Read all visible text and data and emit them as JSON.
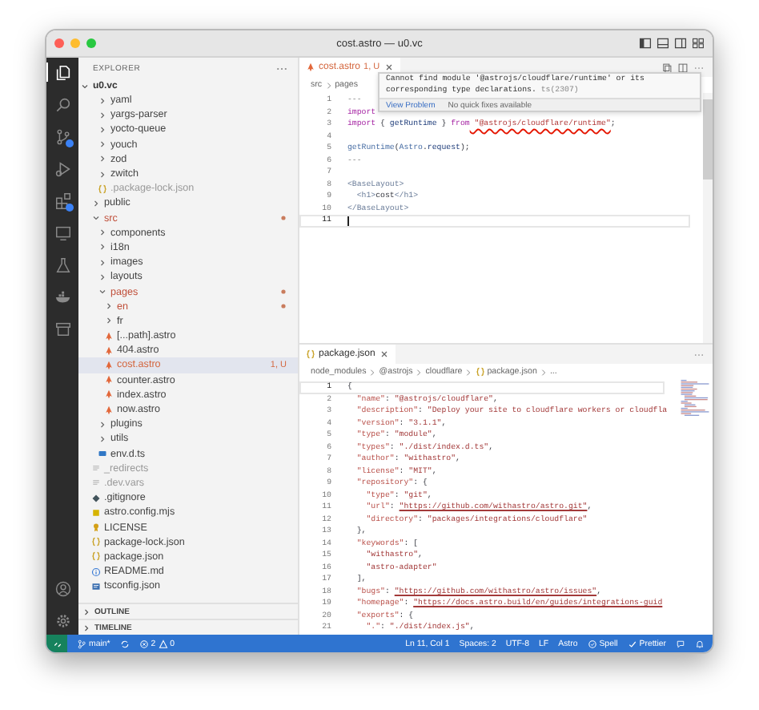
{
  "window": {
    "title": "cost.astro — u0.vc"
  },
  "activity_bar": [
    {
      "kind": "explorer",
      "selected": true,
      "badge": false
    },
    {
      "kind": "search",
      "selected": false,
      "badge": false
    },
    {
      "kind": "source_control",
      "selected": false,
      "badge": true
    },
    {
      "kind": "run",
      "selected": false,
      "badge": false
    },
    {
      "kind": "extensions",
      "selected": false,
      "badge": true
    },
    {
      "kind": "remote",
      "selected": false,
      "badge": false
    },
    {
      "kind": "testing",
      "selected": false,
      "badge": false
    },
    {
      "kind": "docker",
      "selected": false,
      "badge": false
    },
    {
      "kind": "archive",
      "selected": false,
      "badge": false
    }
  ],
  "activity_bar_bottom": [
    {
      "kind": "account"
    },
    {
      "kind": "settings"
    }
  ],
  "sidebar": {
    "title": "EXPLORER",
    "root": {
      "label": "u0.vc",
      "expanded": true
    },
    "tree": [
      {
        "kind": "continued",
        "children": [
          {
            "label": "yaml",
            "kind": "folder",
            "expanded": false,
            "modified": false,
            "ignored": false,
            "selected": false
          },
          {
            "label": "yargs-parser",
            "kind": "folder",
            "expanded": false,
            "modified": false,
            "ignored": false,
            "selected": false
          },
          {
            "label": "yocto-queue",
            "kind": "folder",
            "expanded": false,
            "modified": false,
            "ignored": false,
            "selected": false
          },
          {
            "label": "youch",
            "kind": "folder",
            "expanded": false,
            "modified": false,
            "ignored": false,
            "selected": false
          },
          {
            "label": "zod",
            "kind": "folder",
            "expanded": false,
            "modified": false,
            "ignored": false,
            "selected": false
          },
          {
            "label": "zwitch",
            "kind": "folder",
            "expanded": false,
            "modified": false,
            "ignored": false,
            "selected": false
          },
          {
            "label": ".package-lock.json",
            "kind": "json",
            "modified": false,
            "ignored": true,
            "selected": false
          }
        ]
      },
      {
        "label": "public",
        "kind": "folder",
        "expanded": false,
        "modified": false,
        "ignored": false,
        "selected": false
      },
      {
        "label": "src",
        "kind": "folder",
        "expanded": true,
        "modified": true,
        "ignored": false,
        "selected": false,
        "children": [
          {
            "label": "components",
            "kind": "folder",
            "expanded": false,
            "modified": false,
            "ignored": false,
            "selected": false
          },
          {
            "label": "i18n",
            "kind": "folder",
            "expanded": false,
            "modified": false,
            "ignored": false,
            "selected": false
          },
          {
            "label": "images",
            "kind": "folder",
            "expanded": false,
            "modified": false,
            "ignored": false,
            "selected": false
          },
          {
            "label": "layouts",
            "kind": "folder",
            "expanded": false,
            "modified": false,
            "ignored": false,
            "selected": false
          },
          {
            "label": "pages",
            "kind": "folder",
            "expanded": true,
            "modified": true,
            "ignored": false,
            "selected": false,
            "children": [
              {
                "label": "en",
                "kind": "folder",
                "expanded": false,
                "modified": true,
                "ignored": false,
                "selected": false
              },
              {
                "label": "fr",
                "kind": "folder",
                "expanded": false,
                "modified": false,
                "ignored": false,
                "selected": false
              },
              {
                "label": "[...path].astro",
                "kind": "astro",
                "modified": false,
                "ignored": false,
                "selected": false
              },
              {
                "label": "404.astro",
                "kind": "astro",
                "modified": false,
                "ignored": false,
                "selected": false
              },
              {
                "label": "cost.astro",
                "kind": "astro",
                "modified": false,
                "ignored": false,
                "decoration": "1, U",
                "selected": true
              },
              {
                "label": "counter.astro",
                "kind": "astro",
                "modified": false,
                "ignored": false,
                "selected": false
              },
              {
                "label": "index.astro",
                "kind": "astro",
                "modified": false,
                "ignored": false,
                "selected": false
              },
              {
                "label": "now.astro",
                "kind": "astro",
                "modified": false,
                "ignored": false,
                "selected": false
              }
            ]
          },
          {
            "label": "plugins",
            "kind": "folder",
            "expanded": false,
            "modified": false,
            "ignored": false,
            "selected": false
          },
          {
            "label": "utils",
            "kind": "folder",
            "expanded": false,
            "modified": false,
            "ignored": false,
            "selected": false
          },
          {
            "label": "env.d.ts",
            "kind": "ts",
            "modified": false,
            "ignored": false,
            "selected": false
          }
        ]
      },
      {
        "label": "_redirects",
        "kind": "text",
        "modified": false,
        "ignored": true,
        "selected": false
      },
      {
        "label": ".dev.vars",
        "kind": "text",
        "modified": false,
        "ignored": true,
        "selected": false
      },
      {
        "label": ".gitignore",
        "kind": "git",
        "modified": false,
        "ignored": false,
        "selected": false
      },
      {
        "label": "astro.config.mjs",
        "kind": "js",
        "modified": false,
        "ignored": false,
        "selected": false
      },
      {
        "label": "LICENSE",
        "kind": "license",
        "modified": false,
        "ignored": false,
        "selected": false
      },
      {
        "label": "package-lock.json",
        "kind": "json",
        "modified": false,
        "ignored": false,
        "selected": false
      },
      {
        "label": "package.json",
        "kind": "json",
        "modified": false,
        "ignored": false,
        "selected": false
      },
      {
        "label": "README.md",
        "kind": "info",
        "modified": false,
        "ignored": false,
        "selected": false
      },
      {
        "label": "tsconfig.json",
        "kind": "tsconfig",
        "modified": false,
        "ignored": false,
        "selected": false
      }
    ],
    "sections": [
      {
        "label": "OUTLINE",
        "expanded": false
      },
      {
        "label": "TIMELINE",
        "expanded": false
      }
    ]
  },
  "editors": [
    {
      "tab": {
        "label": "cost.astro",
        "kind": "astro",
        "decoration": "1, U",
        "selected": true
      },
      "breadcrumb": [
        {
          "label": "src",
          "kind": "folder"
        },
        {
          "label": "pages",
          "kind": "folder"
        }
      ],
      "lines": [
        {
          "number": "1",
          "current": false,
          "tokens": [
            {
              "text": "---",
              "kind": "punct"
            }
          ]
        },
        {
          "number": "2",
          "current": false,
          "tokens": [
            {
              "text": "import",
              "kind": "keyword"
            }
          ]
        },
        {
          "number": "3",
          "current": false,
          "tokens": [
            {
              "text": "import",
              "kind": "keyword"
            },
            {
              "text": " { ",
              "kind": "text"
            },
            {
              "text": "getRuntime",
              "kind": "variable"
            },
            {
              "text": " } ",
              "kind": "text"
            },
            {
              "text": "from",
              "kind": "keyword"
            },
            {
              "text": " \"@astrojs/cloudflare/runtime\"",
              "kind": "error"
            },
            {
              "text": ";",
              "kind": "text"
            }
          ]
        },
        {
          "number": "4",
          "current": false
        },
        {
          "number": "5",
          "current": false,
          "tokens": [
            {
              "text": "getRuntime",
              "kind": "function"
            },
            {
              "text": "(",
              "kind": "text"
            },
            {
              "text": "Astro",
              "kind": "type"
            },
            {
              "text": ".",
              "kind": "text"
            },
            {
              "text": "request",
              "kind": "variable"
            },
            {
              "text": ");",
              "kind": "text"
            }
          ]
        },
        {
          "number": "6",
          "current": false,
          "tokens": [
            {
              "text": "---",
              "kind": "punct"
            }
          ]
        },
        {
          "number": "7",
          "current": false
        },
        {
          "number": "8",
          "current": false,
          "tokens": [
            {
              "text": "<BaseLayout>",
              "kind": "tag"
            }
          ]
        },
        {
          "number": "9",
          "current": false,
          "tokens": [
            {
              "text": "  <h1>",
              "kind": "tag"
            },
            {
              "text": "cost",
              "kind": "text"
            },
            {
              "text": "</h1>",
              "kind": "tag"
            }
          ]
        },
        {
          "number": "10",
          "current": false,
          "tokens": [
            {
              "text": "</BaseLayout>",
              "kind": "tag"
            }
          ]
        },
        {
          "number": "11",
          "current": true
        }
      ],
      "hover": {
        "message": "Cannot find module '@astrojs/cloudflare/runtime' or its corresponding type declarations.",
        "code": "ts(2307)",
        "actions": [
          "View Problem",
          "No quick fixes available"
        ]
      }
    },
    {
      "tab": {
        "label": "package.json",
        "kind": "json",
        "selected": true
      },
      "breadcrumb": [
        {
          "label": "node_modules",
          "kind": "folder"
        },
        {
          "label": "@astrojs",
          "kind": "folder"
        },
        {
          "label": "cloudflare",
          "kind": "folder"
        },
        {
          "label": "package.json",
          "kind": "json"
        },
        {
          "label": "...",
          "kind": "folder"
        }
      ],
      "lines": [
        {
          "number": "1",
          "current": true,
          "tokens": [
            {
              "text": "{",
              "kind": "text"
            }
          ]
        },
        {
          "number": "2",
          "current": false,
          "tokens": [
            {
              "text": "  \"name\"",
              "kind": "key"
            },
            {
              "text": ": ",
              "kind": "text"
            },
            {
              "text": "\"@astrojs/cloudflare\"",
              "kind": "string"
            },
            {
              "text": ",",
              "kind": "text"
            }
          ]
        },
        {
          "number": "3",
          "current": false,
          "tokens": [
            {
              "text": "  \"description\"",
              "kind": "key"
            },
            {
              "text": ": ",
              "kind": "text"
            },
            {
              "text": "\"Deploy your site to cloudflare workers or cloudfla",
              "kind": "string"
            }
          ]
        },
        {
          "number": "4",
          "current": false,
          "tokens": [
            {
              "text": "  \"version\"",
              "kind": "key"
            },
            {
              "text": ": ",
              "kind": "text"
            },
            {
              "text": "\"3.1.1\"",
              "kind": "string"
            },
            {
              "text": ",",
              "kind": "text"
            }
          ]
        },
        {
          "number": "5",
          "current": false,
          "tokens": [
            {
              "text": "  \"type\"",
              "kind": "key"
            },
            {
              "text": ": ",
              "kind": "text"
            },
            {
              "text": "\"module\"",
              "kind": "string"
            },
            {
              "text": ",",
              "kind": "text"
            }
          ]
        },
        {
          "number": "6",
          "current": false,
          "tokens": [
            {
              "text": "  \"types\"",
              "kind": "key"
            },
            {
              "text": ": ",
              "kind": "text"
            },
            {
              "text": "\"./dist/index.d.ts\"",
              "kind": "string"
            },
            {
              "text": ",",
              "kind": "text"
            }
          ]
        },
        {
          "number": "7",
          "current": false,
          "tokens": [
            {
              "text": "  \"author\"",
              "kind": "key"
            },
            {
              "text": ": ",
              "kind": "text"
            },
            {
              "text": "\"withastro\"",
              "kind": "string"
            },
            {
              "text": ",",
              "kind": "text"
            }
          ]
        },
        {
          "number": "8",
          "current": false,
          "tokens": [
            {
              "text": "  \"license\"",
              "kind": "key"
            },
            {
              "text": ": ",
              "kind": "text"
            },
            {
              "text": "\"MIT\"",
              "kind": "string"
            },
            {
              "text": ",",
              "kind": "text"
            }
          ]
        },
        {
          "number": "9",
          "current": false,
          "tokens": [
            {
              "text": "  \"repository\"",
              "kind": "key"
            },
            {
              "text": ": {",
              "kind": "text"
            }
          ]
        },
        {
          "number": "10",
          "current": false,
          "tokens": [
            {
              "text": "    \"type\"",
              "kind": "key"
            },
            {
              "text": ": ",
              "kind": "text"
            },
            {
              "text": "\"git\"",
              "kind": "string"
            },
            {
              "text": ",",
              "kind": "text"
            }
          ]
        },
        {
          "number": "11",
          "current": false,
          "tokens": [
            {
              "text": "    \"url\"",
              "kind": "key"
            },
            {
              "text": ": ",
              "kind": "text"
            },
            {
              "text": "\"https://github.com/withastro/astro.git\"",
              "kind": "link"
            },
            {
              "text": ",",
              "kind": "text"
            }
          ]
        },
        {
          "number": "12",
          "current": false,
          "tokens": [
            {
              "text": "    \"directory\"",
              "kind": "key"
            },
            {
              "text": ": ",
              "kind": "text"
            },
            {
              "text": "\"packages/integrations/cloudflare\"",
              "kind": "string"
            }
          ]
        },
        {
          "number": "13",
          "current": false,
          "tokens": [
            {
              "text": "  },",
              "kind": "text"
            }
          ]
        },
        {
          "number": "14",
          "current": false,
          "tokens": [
            {
              "text": "  \"keywords\"",
              "kind": "key"
            },
            {
              "text": ": [",
              "kind": "text"
            }
          ]
        },
        {
          "number": "15",
          "current": false,
          "tokens": [
            {
              "text": "    \"withastro\"",
              "kind": "string"
            },
            {
              "text": ",",
              "kind": "text"
            }
          ]
        },
        {
          "number": "16",
          "current": false,
          "tokens": [
            {
              "text": "    \"astro-adapter\"",
              "kind": "string"
            }
          ]
        },
        {
          "number": "17",
          "current": false,
          "tokens": [
            {
              "text": "  ],",
              "kind": "text"
            }
          ]
        },
        {
          "number": "18",
          "current": false,
          "tokens": [
            {
              "text": "  \"bugs\"",
              "kind": "key"
            },
            {
              "text": ": ",
              "kind": "text"
            },
            {
              "text": "\"https://github.com/withastro/astro/issues\"",
              "kind": "link"
            },
            {
              "text": ",",
              "kind": "text"
            }
          ]
        },
        {
          "number": "19",
          "current": false,
          "tokens": [
            {
              "text": "  \"homepage\"",
              "kind": "key"
            },
            {
              "text": ": ",
              "kind": "text"
            },
            {
              "text": "\"https://docs.astro.build/en/guides/integrations-guid",
              "kind": "link"
            }
          ]
        },
        {
          "number": "20",
          "current": false,
          "tokens": [
            {
              "text": "  \"exports\"",
              "kind": "key"
            },
            {
              "text": ": {",
              "kind": "text"
            }
          ]
        },
        {
          "number": "21",
          "current": false,
          "tokens": [
            {
              "text": "    \".\"",
              "kind": "key"
            },
            {
              "text": ": ",
              "kind": "text"
            },
            {
              "text": "\"./dist/index.js\"",
              "kind": "string"
            },
            {
              "text": ",",
              "kind": "text"
            }
          ]
        }
      ]
    }
  ],
  "status_bar": {
    "branch": "main*",
    "errors": "2",
    "warnings": "0",
    "items": [
      "Ln 11, Col 1",
      "Spaces: 2",
      "UTF-8",
      "LF",
      "Astro"
    ],
    "spell": "Spell",
    "prettier": "Prettier"
  }
}
